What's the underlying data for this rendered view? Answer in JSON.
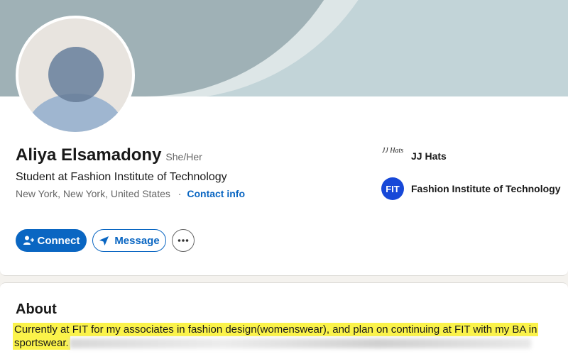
{
  "profile": {
    "name": "Aliya Elsamadony",
    "pronouns": "She/Her",
    "headline": "Student at Fashion Institute of Technology",
    "location": "New York, New York, United States",
    "separator": "·",
    "contact_info": "Contact info"
  },
  "actions": {
    "connect_label": "Connect",
    "message_label": "Message",
    "more_label": "•••"
  },
  "organizations": [
    {
      "name": "JJ Hats",
      "logo_text": "JJ Hats"
    },
    {
      "name": "Fashion Institute of Technology",
      "logo_text": "FIT"
    }
  ],
  "about": {
    "title": "About",
    "text": "Currently at FIT for my associates in fashion design(womenswear), and plan on continuing at FIT with my BA in sportswear."
  },
  "colors": {
    "accent": "#0a66c2",
    "highlight": "#fbf34a",
    "fit_logo": "#1748d8"
  }
}
